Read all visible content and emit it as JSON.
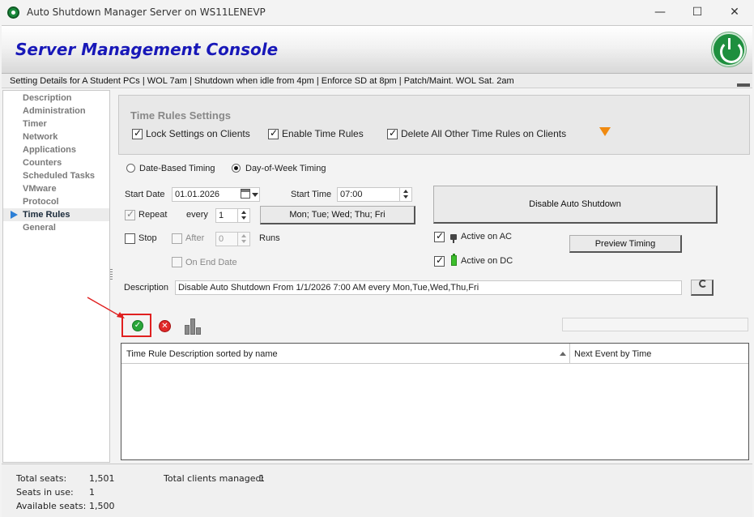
{
  "window": {
    "title": "Auto Shutdown Manager Server on WS11LENEVP",
    "minimize": "—",
    "maximize": "☐",
    "close": "✕"
  },
  "header": {
    "title": "Server Management Console"
  },
  "details": "Setting Details for A Student PCs | WOL 7am | Shutdown when idle from 4pm | Enforce SD at 8pm | Patch/Maint. WOL Sat. 2am",
  "sidebar": {
    "items": [
      {
        "label": "Description"
      },
      {
        "label": "Administration"
      },
      {
        "label": "Timer"
      },
      {
        "label": "Network"
      },
      {
        "label": "Applications"
      },
      {
        "label": "Counters"
      },
      {
        "label": "Scheduled Tasks"
      },
      {
        "label": "VMware"
      },
      {
        "label": "Protocol"
      },
      {
        "label": "Time Rules"
      },
      {
        "label": "General"
      }
    ],
    "active": "Time Rules"
  },
  "time_rules": {
    "group_title": "Time Rules Settings",
    "lock_settings": {
      "label": "Lock Settings on Clients",
      "checked": true
    },
    "enable_rules": {
      "label": "Enable Time Rules",
      "checked": true
    },
    "delete_other": {
      "label": "Delete All Other Time Rules on Clients",
      "checked": true
    },
    "timing_mode": {
      "date_based": "Date-Based Timing",
      "day_of_week": "Day-of-Week Timing",
      "selected": "Day-of-Week Timing"
    },
    "start_date_label": "Start Date",
    "start_date": "01.01.2026",
    "start_time_label": "Start Time",
    "start_time": "07:00",
    "action_button": "Disable Auto Shutdown",
    "repeat_label": "Repeat",
    "repeat_checked": true,
    "every_label": "every",
    "every_value": "1",
    "days_button": "Mon; Tue; Wed; Thu; Fri",
    "stop_label": "Stop",
    "after_label": "After",
    "runs_value": "0",
    "runs_label": "Runs",
    "end_date_label": "On End Date",
    "active_ac": {
      "label": "Active on AC",
      "checked": true
    },
    "active_dc": {
      "label": "Active on DC",
      "checked": true
    },
    "preview_button": "Preview Timing",
    "description_label": "Description",
    "description_value": "Disable Auto Shutdown From 1/1/2026 7:00 AM every Mon,Tue,Wed,Thu,Fri"
  },
  "toolbar": {
    "apply_glyph": "✓",
    "cancel_glyph": "✕"
  },
  "table": {
    "columns": [
      "Time Rule Description sorted by name",
      "Next Event by Time"
    ],
    "rows": []
  },
  "footer": {
    "total_seats_label": "Total seats:",
    "total_seats": "1,501",
    "seats_in_use_label": "Seats in use:",
    "seats_in_use": "1",
    "available_label": "Available seats:",
    "available": "1,500",
    "clients_managed_label": "Total clients managed:",
    "clients_managed": "1"
  },
  "colors": {
    "title_blue": "#1818b8",
    "nav_arrow": "#2d7fd6",
    "apply_green": "#2aa63a",
    "cancel_red": "#e02828",
    "highlight_red": "#e02020",
    "warning_orange": "#f08a10"
  }
}
